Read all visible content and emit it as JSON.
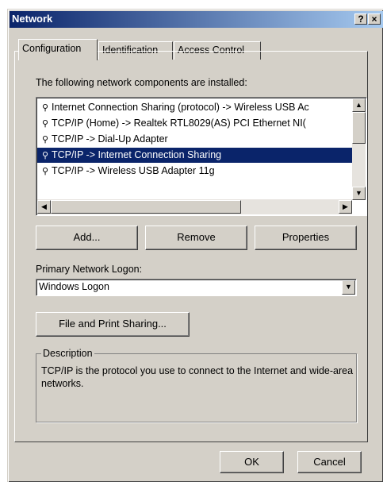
{
  "window": {
    "title": "Network",
    "help_btn": "?",
    "close_btn": "×"
  },
  "tabs": [
    {
      "label": "Configuration",
      "active": true
    },
    {
      "label": "Identification",
      "active": false
    },
    {
      "label": "Access Control",
      "active": false
    }
  ],
  "components": {
    "label": "The following network components are installed:",
    "items": [
      {
        "icon": "network-protocol-icon",
        "label": "Internet Connection Sharing (protocol) -> Wireless USB Ac",
        "selected": false
      },
      {
        "icon": "network-protocol-icon",
        "label": "TCP/IP (Home) -> Realtek RTL8029(AS) PCI Ethernet NI(",
        "selected": false
      },
      {
        "icon": "network-protocol-icon",
        "label": "TCP/IP -> Dial-Up Adapter",
        "selected": false
      },
      {
        "icon": "network-protocol-icon",
        "label": "TCP/IP -> Internet Connection Sharing",
        "selected": true
      },
      {
        "icon": "network-protocol-icon",
        "label": "TCP/IP -> Wireless USB Adapter 11g",
        "selected": false
      }
    ]
  },
  "buttons": {
    "add": "Add...",
    "remove": "Remove",
    "properties": "Properties",
    "file_print": "File and Print Sharing...",
    "ok": "OK",
    "cancel": "Cancel"
  },
  "logon": {
    "label": "Primary Network Logon:",
    "value": "Windows Logon"
  },
  "description": {
    "title": "Description",
    "text": "TCP/IP is the protocol you use to connect to the Internet and wide-area networks."
  }
}
